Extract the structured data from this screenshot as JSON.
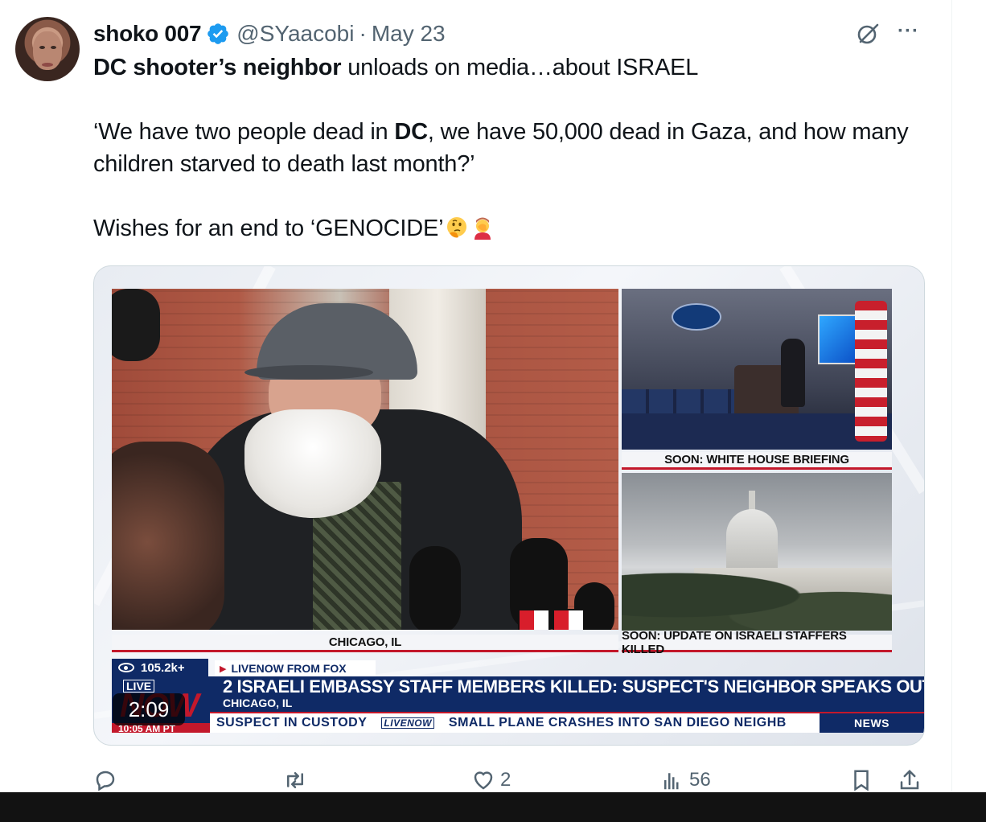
{
  "tweet": {
    "author": {
      "display_name": "shoko 007",
      "handle": "@SYaacobi",
      "verified": true
    },
    "separator": "·",
    "date": "May 23",
    "text": {
      "line1_bold": "DC shooter’s neighbor",
      "line1_rest": " unloads on media…about ISRAEL",
      "line2_a": "‘We have two people dead in ",
      "line2_bold": "DC",
      "line2_b": ", we have 50,000 dead in Gaza, and how many children starved to death last month?’",
      "line3": "Wishes for an end to ‘GENOCIDE’",
      "emojis": [
        "thinking-face",
        "face-palm"
      ]
    },
    "icons": {
      "grok": "grok-icon",
      "more": "more-options-icon"
    }
  },
  "video": {
    "duration": "2:09",
    "captions": {
      "main": "CHICAGO, IL",
      "white_house": "SOON: WHITE HOUSE BRIEFING",
      "capitol": "SOON: UPDATE ON ISRAELI STAFFERS KILLED"
    },
    "lower_third": {
      "views": "105.2k+",
      "livenow_tag": "LIVENOW FROM FOX",
      "live_label": "LIVE",
      "now_label": "NOW",
      "time_label": "10:05 AM PT",
      "headline": "2 ISRAELI EMBASSY STAFF MEMBERS KILLED: SUSPECT'S NEIGHBOR SPEAKS OUT",
      "sub_location": "CHICAGO, IL",
      "ticker_left": "SUSPECT  IN  CUSTODY",
      "ticker_livenow": "LIVENOW",
      "ticker_right": "SMALL  PLANE  CRASHES  INTO  SAN  DIEGO  NEIGHB",
      "news_tab": "NEWS"
    }
  },
  "actions": {
    "reply_count": "",
    "repost_count": "",
    "like_count": "2",
    "views_count": "56"
  },
  "colors": {
    "verified_blue": "#1d9bf0",
    "text_primary": "#0f1419",
    "text_secondary": "#536471",
    "fox_navy": "#0f2a66",
    "fox_red": "#c3182b"
  }
}
